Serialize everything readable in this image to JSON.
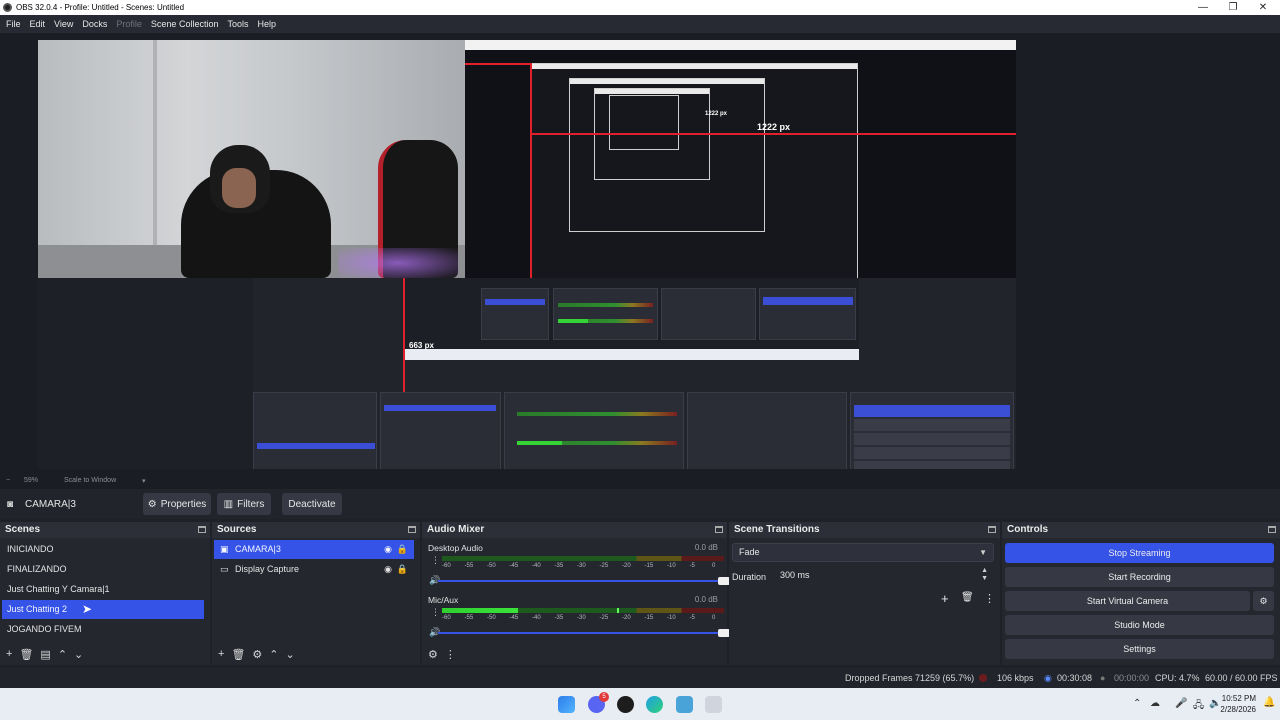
{
  "window": {
    "title": "OBS 32.0.4 - Profile: Untitled - Scenes: Untitled",
    "controls": [
      "—",
      "❐",
      "✕"
    ]
  },
  "menu": {
    "items": [
      "File",
      "Edit",
      "View",
      "Docks",
      "Profile",
      "Scene Collection",
      "Tools",
      "Help"
    ],
    "disabled": [
      "Profile"
    ]
  },
  "preview": {
    "nested_width_label": "1222 px",
    "nested_height_label": "663 px",
    "nested_small_label": "1222 px"
  },
  "zoom": {
    "minus": "−",
    "value": "59%",
    "mode": "Scale to Window"
  },
  "source_toolbar": {
    "source_name": "CAMARA|3",
    "properties_label": "Properties",
    "filters_label": "Filters",
    "deactivate_label": "Deactivate"
  },
  "scenes": {
    "title": "Scenes",
    "items": [
      "INICIANDO",
      "FINALIZANDO",
      "Just Chatting  Y  Camara|1",
      "Just Chatting 2",
      "JOGANDO FIVEM"
    ],
    "selected_index": 3
  },
  "sources": {
    "title": "Sources",
    "items": [
      "CAMARA|3",
      "Display Capture"
    ],
    "selected_index": 0
  },
  "mixer": {
    "title": "Audio Mixer",
    "channels": [
      {
        "name": "Desktop Audio",
        "db": "0.0 dB",
        "level": 0.0,
        "peak": 0.0
      },
      {
        "name": "Mic/Aux",
        "db": "0.0 dB",
        "level": 0.27,
        "peak": 0.62
      }
    ],
    "scale": [
      "-60",
      "-55",
      "-50",
      "-45",
      "-40",
      "-35",
      "-30",
      "-25",
      "-20",
      "-15",
      "-10",
      "-5",
      "0"
    ]
  },
  "transitions": {
    "title": "Scene Transitions",
    "selected": "Fade",
    "duration_label": "Duration",
    "duration_value": "300 ms"
  },
  "controls": {
    "title": "Controls",
    "buttons": [
      "Stop Streaming",
      "Start Recording",
      "Start Virtual Camera",
      "Studio Mode",
      "Settings"
    ]
  },
  "status": {
    "dropped_frames": "Dropped Frames 71259 (65.7%)",
    "bitrate": "106 kbps",
    "stream_time": "00:30:08",
    "record_time": "00:00:00",
    "cpu": "CPU: 4.7%",
    "fps": "60.00 / 60.00 FPS"
  },
  "taskbar": {
    "time": "10:52 PM",
    "date": "2/28/2026",
    "badge": "5"
  },
  "colors": {
    "accent": "#3653e8",
    "background": "#1f2129",
    "dock": "#25272f",
    "meter_green": "#3ae33a",
    "guide_red": "#e0202a"
  }
}
